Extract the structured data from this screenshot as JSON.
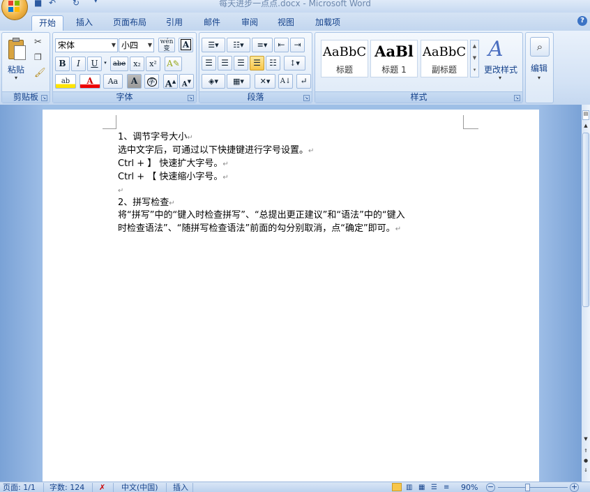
{
  "window": {
    "title": "每天进步一点点.docx - Microsoft Word"
  },
  "quick_access": {
    "save": "💾",
    "undo": "↶",
    "redo": "↻",
    "customize": "▾"
  },
  "tabs": [
    {
      "label": "开始",
      "active": true
    },
    {
      "label": "插入"
    },
    {
      "label": "页面布局"
    },
    {
      "label": "引用"
    },
    {
      "label": "邮件"
    },
    {
      "label": "审阅"
    },
    {
      "label": "视图"
    },
    {
      "label": "加载项"
    }
  ],
  "ribbon": {
    "clipboard": {
      "paste_label": "粘贴",
      "group_label": "剪贴板"
    },
    "font": {
      "font_name": "宋体",
      "font_size": "小四",
      "wen_label": "wén\n变",
      "group_label": "字体",
      "bold": "B",
      "italic": "I",
      "underline": "U",
      "strike": "abe",
      "subscript": "x₂",
      "superscript": "x²",
      "clear_format": "A",
      "highlight": "ab",
      "font_color": "A",
      "change_case": "Aa",
      "char_shading": "A",
      "enclose": "字",
      "grow": "A",
      "shrink": "A"
    },
    "paragraph": {
      "group_label": "段落"
    },
    "styles": {
      "group_label": "样式",
      "items": [
        {
          "sample": "AaBbC",
          "name": "标题"
        },
        {
          "sample": "AaBl",
          "name": "标题 1"
        },
        {
          "sample": "AaBbC",
          "name": "副标题"
        }
      ],
      "change_styles": "更改样式"
    },
    "editing": {
      "label": "编辑"
    }
  },
  "document": {
    "lines": [
      "1、调节字号大小",
      "选中文字后，可通过以下快捷键进行字号设置。",
      "Ctrl + 】 快速扩大字号。",
      "Ctrl + 【  快速缩小字号。",
      "",
      "2、拼写检查",
      "将“拼写”中的“键入时检查拼写”、“总提出更正建议”和“语法”中的“键入",
      "时检查语法”、“随拼写检查语法”前面的勾分别取消，点“确定”即可。"
    ],
    "paragraph_mark": "↵"
  },
  "statusbar": {
    "page": "页面: 1/1",
    "words": "字数: 124",
    "language": "中文(中国)",
    "mode": "插入",
    "zoom": "90%"
  }
}
